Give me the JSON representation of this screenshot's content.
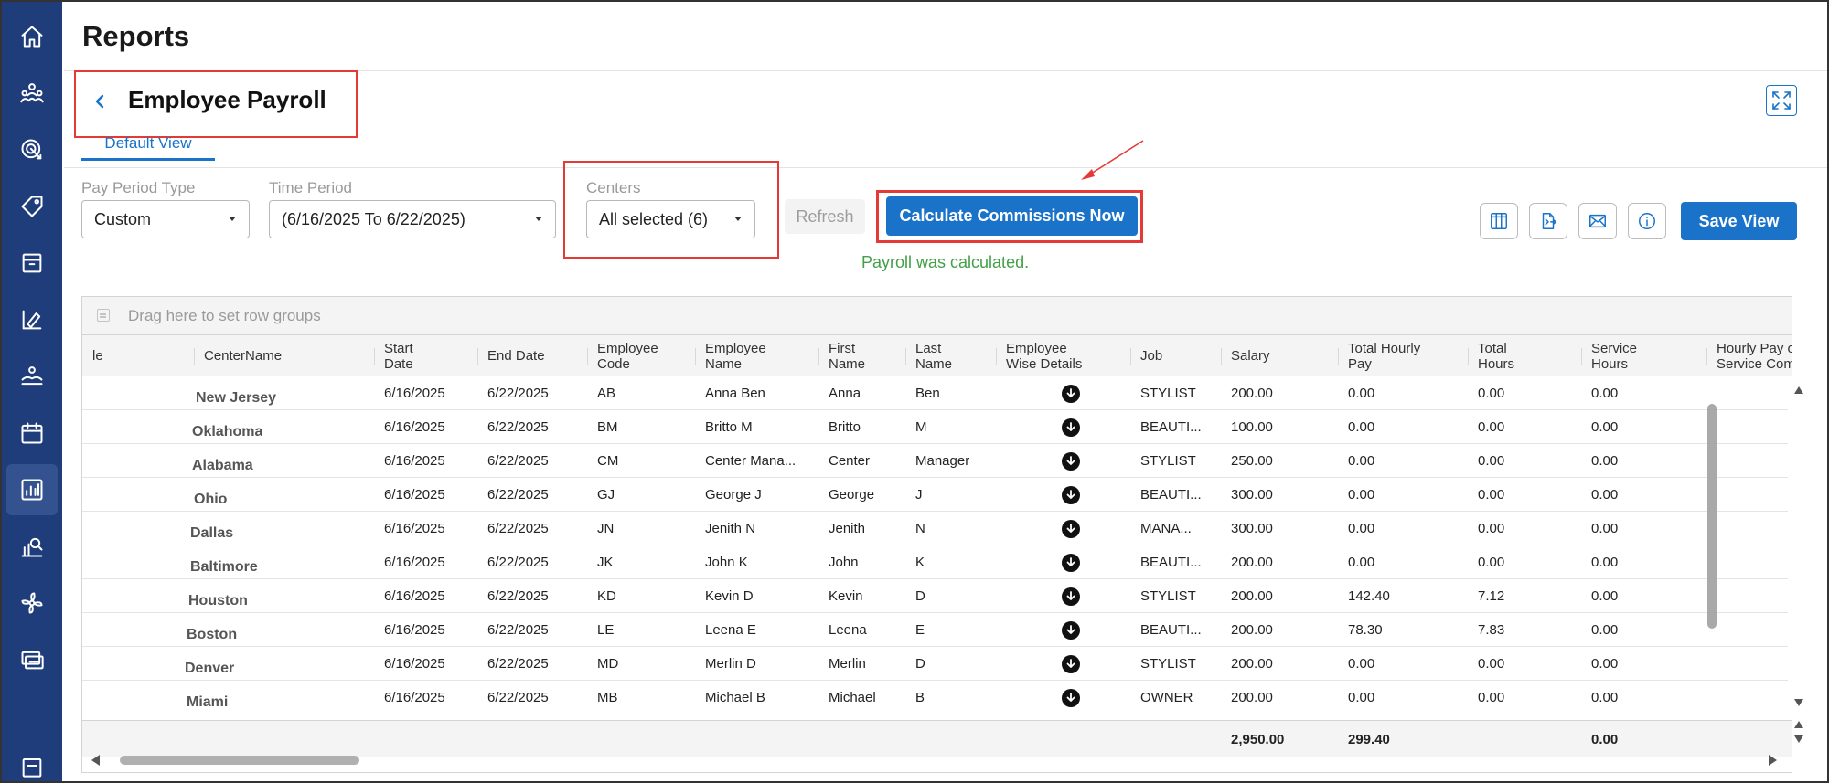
{
  "page": {
    "title": "Reports"
  },
  "report": {
    "title": "Employee Payroll",
    "tab": "Default View"
  },
  "filters": {
    "pay_period_type": {
      "label": "Pay Period Type",
      "value": "Custom"
    },
    "time_period": {
      "label": "Time Period",
      "value": "(6/16/2025 To 6/22/2025)"
    },
    "centers": {
      "label": "Centers",
      "value": "All selected (6)"
    }
  },
  "actions": {
    "refresh": "Refresh",
    "calculate": "Calculate Commissions Now",
    "save_view": "Save View",
    "status_message": "Payroll was calculated."
  },
  "sidebar": {
    "items": [
      "home-icon",
      "team-icon",
      "marketing-icon",
      "tag-icon",
      "box-icon",
      "services-icon",
      "appointments-icon",
      "calendar-icon",
      "reports-icon",
      "analytics-icon",
      "spa-icon",
      "payments-icon"
    ],
    "active_index": 8
  },
  "toolbar_icons": [
    "columns-icon",
    "export-icon",
    "email-icon",
    "info-icon"
  ],
  "colors": {
    "primary": "#1a73c9",
    "sidebar": "#1f3d7a",
    "highlight": "#e53935",
    "success": "#43a047"
  },
  "grid": {
    "group_placeholder": "Drag here to set row groups",
    "columns": [
      {
        "key": "cut",
        "label": "le"
      },
      {
        "key": "center",
        "label": "CenterName"
      },
      {
        "key": "start",
        "label": "Start\nDate"
      },
      {
        "key": "end",
        "label": "End Date"
      },
      {
        "key": "code",
        "label": "Employee\nCode"
      },
      {
        "key": "name",
        "label": "Employee\nName"
      },
      {
        "key": "first",
        "label": "First\nName"
      },
      {
        "key": "last",
        "label": "Last\nName"
      },
      {
        "key": "details",
        "label": "Employee\nWise Details"
      },
      {
        "key": "job",
        "label": "Job"
      },
      {
        "key": "salary",
        "label": "Salary"
      },
      {
        "key": "hourly_pay",
        "label": "Total Hourly\nPay"
      },
      {
        "key": "total_hours",
        "label": "Total\nHours"
      },
      {
        "key": "service_hours",
        "label": "Service\nHours"
      },
      {
        "key": "hourly_or_comm",
        "label": "Hourly Pay or\nService Commis"
      }
    ],
    "rows": [
      {
        "center": "New Jersey",
        "start": "6/16/2025",
        "end": "6/22/2025",
        "code": "AB",
        "name": "Anna Ben",
        "first": "Anna",
        "last": "Ben",
        "job": "STYLIST",
        "salary": "200.00",
        "hourly_pay": "0.00",
        "total_hours": "0.00",
        "service_hours": "0.00"
      },
      {
        "center": "Oklahoma",
        "start": "6/16/2025",
        "end": "6/22/2025",
        "code": "BM",
        "name": "Britto M",
        "first": "Britto",
        "last": "M",
        "job": "BEAUTI...",
        "salary": "100.00",
        "hourly_pay": "0.00",
        "total_hours": "0.00",
        "service_hours": "0.00"
      },
      {
        "center": "Alabama",
        "start": "6/16/2025",
        "end": "6/22/2025",
        "code": "CM",
        "name": "Center Mana...",
        "first": "Center",
        "last": "Manager",
        "job": "STYLIST",
        "salary": "250.00",
        "hourly_pay": "0.00",
        "total_hours": "0.00",
        "service_hours": "0.00"
      },
      {
        "center": "Ohio",
        "start": "6/16/2025",
        "end": "6/22/2025",
        "code": "GJ",
        "name": "George J",
        "first": "George",
        "last": "J",
        "job": "BEAUTI...",
        "salary": "300.00",
        "hourly_pay": "0.00",
        "total_hours": "0.00",
        "service_hours": "0.00"
      },
      {
        "center": "Dallas",
        "start": "6/16/2025",
        "end": "6/22/2025",
        "code": "JN",
        "name": "Jenith N",
        "first": "Jenith",
        "last": "N",
        "job": "MANA...",
        "salary": "300.00",
        "hourly_pay": "0.00",
        "total_hours": "0.00",
        "service_hours": "0.00"
      },
      {
        "center": "Baltimore",
        "start": "6/16/2025",
        "end": "6/22/2025",
        "code": "JK",
        "name": "John K",
        "first": "John",
        "last": "K",
        "job": "BEAUTI...",
        "salary": "200.00",
        "hourly_pay": "0.00",
        "total_hours": "0.00",
        "service_hours": "0.00"
      },
      {
        "center": "Houston",
        "start": "6/16/2025",
        "end": "6/22/2025",
        "code": "KD",
        "name": "Kevin D",
        "first": "Kevin",
        "last": "D",
        "job": "STYLIST",
        "salary": "200.00",
        "hourly_pay": "142.40",
        "total_hours": "7.12",
        "service_hours": "0.00"
      },
      {
        "center": "Boston",
        "start": "6/16/2025",
        "end": "6/22/2025",
        "code": "LE",
        "name": "Leena E",
        "first": "Leena",
        "last": "E",
        "job": "BEAUTI...",
        "salary": "200.00",
        "hourly_pay": "78.30",
        "total_hours": "7.83",
        "service_hours": "0.00"
      },
      {
        "center": "Denver",
        "start": "6/16/2025",
        "end": "6/22/2025",
        "code": "MD",
        "name": "Merlin D",
        "first": "Merlin",
        "last": "D",
        "job": "STYLIST",
        "salary": "200.00",
        "hourly_pay": "0.00",
        "total_hours": "0.00",
        "service_hours": "0.00"
      },
      {
        "center": "Miami",
        "start": "6/16/2025",
        "end": "6/22/2025",
        "code": "MB",
        "name": "Michael B",
        "first": "Michael",
        "last": "B",
        "job": "OWNER",
        "salary": "200.00",
        "hourly_pay": "0.00",
        "total_hours": "0.00",
        "service_hours": "0.00"
      }
    ],
    "totals": {
      "salary": "2,950.00",
      "hourly_pay": "299.40",
      "service_hours": "0.00"
    }
  }
}
